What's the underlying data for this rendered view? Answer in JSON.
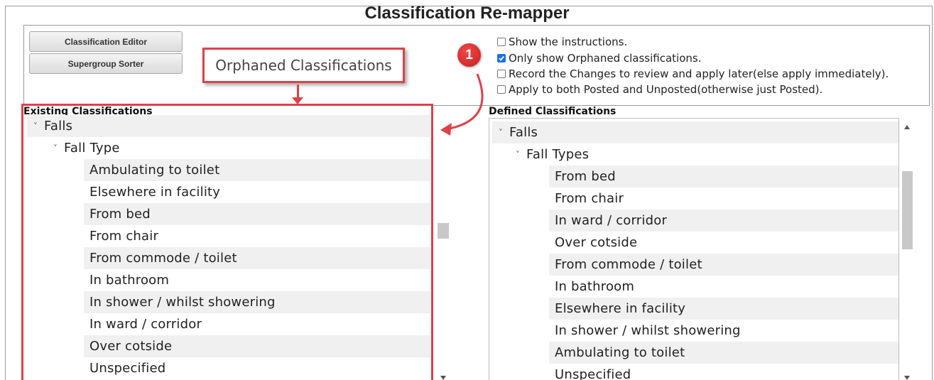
{
  "title": "Classification Re-mapper",
  "buttons": {
    "editor": "Classification Editor",
    "sorter": "Supergroup Sorter"
  },
  "callout": {
    "label": "Orphaned Classifications",
    "step_number": "1"
  },
  "options": [
    {
      "label": "Show the instructions.",
      "checked": false
    },
    {
      "label": "Only show Orphaned classifications.",
      "checked": true
    },
    {
      "label": "Record the Changes to review and apply later(else apply immediately).",
      "checked": false
    },
    {
      "label": "Apply to both Posted and Unposted(otherwise just Posted).",
      "checked": false
    }
  ],
  "existing": {
    "heading": "Existing Classifications",
    "root": "Falls",
    "group": "Fall Type",
    "items": [
      "Ambulating to toilet",
      "Elsewhere in facility",
      "From bed",
      "From chair",
      "From commode / toilet",
      "In bathroom",
      "In shower / whilst showering",
      "In ward / corridor",
      "Over cotside",
      "Unspecified"
    ]
  },
  "defined": {
    "heading": "Defined Classifications",
    "root": "Falls",
    "group": "Fall Types",
    "items": [
      "From bed",
      "From chair",
      "In ward / corridor",
      "Over cotside",
      "From commode / toilet",
      "In bathroom",
      "Elsewhere in facility",
      "In shower / whilst showering",
      "Ambulating to toilet",
      "Unspecified"
    ]
  },
  "colors": {
    "annotation_red": "#e0404a",
    "checkbox_blue": "#1a73e8"
  }
}
